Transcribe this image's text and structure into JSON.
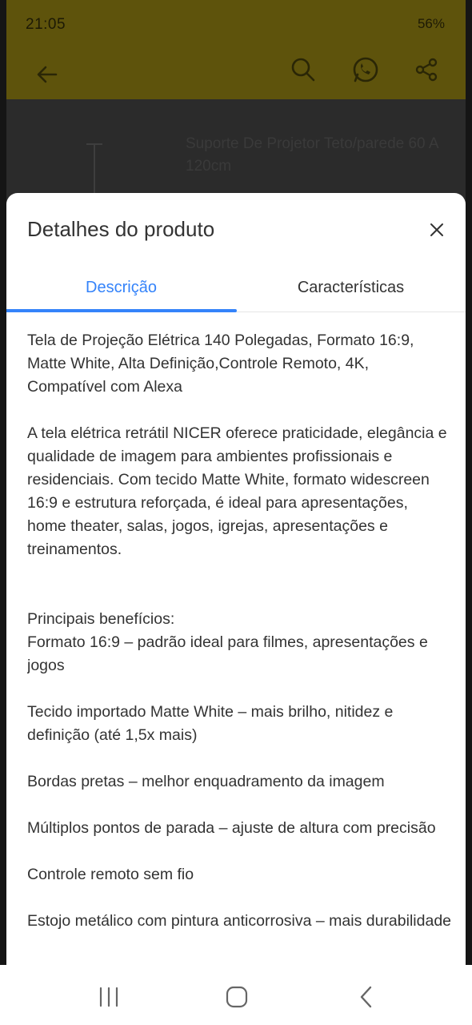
{
  "status_bar": {
    "time": "21:05",
    "indicators": "56%"
  },
  "app_bar": {
    "icons": [
      "back-arrow-icon",
      "search-icon",
      "whatsapp-icon",
      "share-icon"
    ]
  },
  "background_product": {
    "title": "Suporte De Projetor Teto/parede 60 A 120cm"
  },
  "sheet": {
    "title": "Detalhes do produto",
    "close_icon": "close-icon",
    "tabs": [
      {
        "label": "Descrição",
        "active": true
      },
      {
        "label": "Características",
        "active": false
      }
    ],
    "paragraphs": [
      "Tela de Projeção Elétrica 140 Polegadas, Formato 16:9, Matte White, Alta Definição,Controle Remoto, 4K, Compatível com Alexa",
      "A tela elétrica retrátil NICER oferece praticidade, elegância e qualidade de imagem para ambientes profissionais e residenciais. Com tecido Matte White, formato widescreen 16:9 e estrutura reforçada, é ideal para apresentações, home theater, salas, jogos, igrejas, apresentações e treinamentos.",
      "Principais benefícios:\nFormato 16:9 – padrão ideal para filmes, apresentações e jogos",
      "Tecido importado Matte White – mais brilho, nitidez e definição (até 1,5x mais)",
      "Bordas pretas – melhor enquadramento da imagem",
      "Múltiplos pontos de parada – ajuste de altura com precisão",
      "Controle remoto sem fio",
      "Estojo metálico com pintura anticorrosiva – mais durabilidade"
    ]
  },
  "nav_bar": {
    "icons": [
      "recent-apps-icon",
      "home-icon",
      "back-icon"
    ]
  },
  "colors": {
    "accent": "#3483fa",
    "text": "#333333",
    "overlay_yellow": "#5e530c"
  }
}
